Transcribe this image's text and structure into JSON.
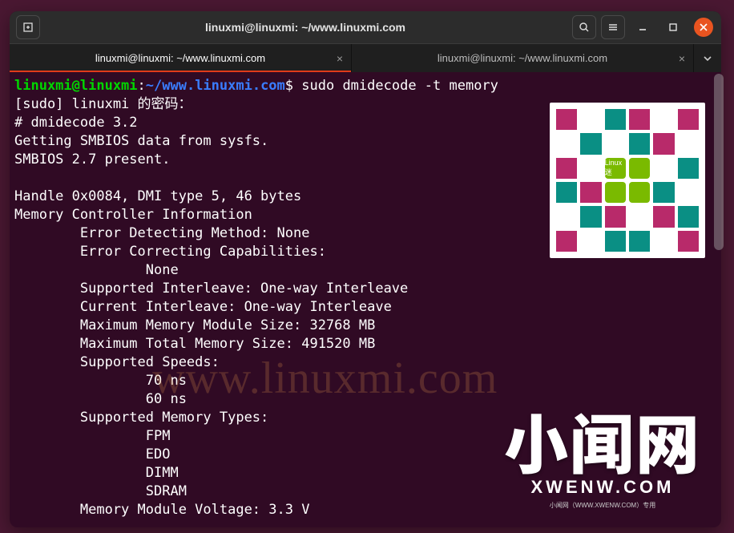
{
  "window": {
    "title": "linuxmi@linuxmi: ~/www.linuxmi.com"
  },
  "tabs": {
    "tab1": "linuxmi@linuxmi: ~/www.linuxmi.com",
    "tab2": "linuxmi@linuxmi: ~/www.linuxmi.com"
  },
  "prompt": {
    "userhost": "linuxmi@linuxmi",
    "colon": ":",
    "path": "~/www.linuxmi.com",
    "dollar": "$ ",
    "command": "sudo dmidecode -t memory"
  },
  "output": [
    "[sudo] linuxmi 的密码：",
    "# dmidecode 3.2",
    "Getting SMBIOS data from sysfs.",
    "SMBIOS 2.7 present.",
    "",
    "Handle 0x0084, DMI type 5, 46 bytes",
    "Memory Controller Information",
    "        Error Detecting Method: None",
    "        Error Correcting Capabilities:",
    "                None",
    "        Supported Interleave: One-way Interleave",
    "        Current Interleave: One-way Interleave",
    "        Maximum Memory Module Size: 32768 MB",
    "        Maximum Total Memory Size: 491520 MB",
    "        Supported Speeds:",
    "                70 ns",
    "                60 ns",
    "        Supported Memory Types:",
    "                FPM",
    "                EDO",
    "                DIMM",
    "                SDRAM",
    "        Memory Module Voltage: 3.3 V"
  ],
  "watermark": "www.linuxmi.com",
  "brand": {
    "big": "小闻网",
    "small": "XWENW.COM",
    "tiny": "小闻网（WWW.XWENW.COM）专用"
  },
  "qr_label": "Linux迷"
}
